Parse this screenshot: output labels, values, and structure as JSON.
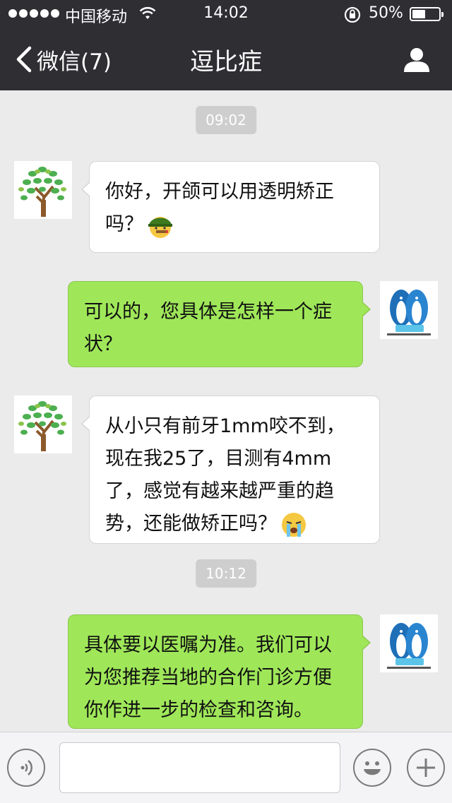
{
  "status_bar": {
    "carrier": "中国移动",
    "time": "14:02",
    "battery_percent": "50%",
    "battery_level": 0.5,
    "signal_icon": "signal-dots-icon",
    "wifi_icon": "wifi-icon",
    "rotation_lock_icon": "rotation-lock-icon"
  },
  "nav": {
    "back_label": "微信(7)",
    "title": "逗比症",
    "profile_icon": "person-icon"
  },
  "chat": {
    "timestamps": [
      "09:02",
      "10:12"
    ],
    "messages": [
      {
        "side": "left",
        "lines": [
          "你好，开颌可以用透明矫正",
          "吗？"
        ],
        "emoji": "cigar-soldier-emoji"
      },
      {
        "side": "right",
        "lines": [
          "可以的，您具体是怎样一个症",
          "状？"
        ]
      },
      {
        "side": "left",
        "lines": [
          "从小只有前牙1mm咬不到，",
          "现在我25了，目测有4mm",
          "了，感觉有越来越严重的趋",
          "势，还能做矫正吗？"
        ],
        "emoji": "crying-emoji"
      },
      {
        "side": "right",
        "lines": [
          "具体要以医嘱为准。我们可以",
          "为您推荐当地的合作门诊方便",
          "你作进一步的检查和咨询。"
        ]
      }
    ],
    "user_avatar_icon": "tree-avatar-icon",
    "agent_avatar_icon": "penguin-logo-avatar-icon"
  },
  "toolbar": {
    "voice_icon": "voice-icon",
    "emoji_icon": "smiley-icon",
    "plus_icon": "plus-icon",
    "input_value": ""
  },
  "colors": {
    "nav_bg": "#2e2e33",
    "chat_bg": "#ebebeb",
    "my_bubble": "#9fe759",
    "their_bubble": "#ffffff"
  }
}
